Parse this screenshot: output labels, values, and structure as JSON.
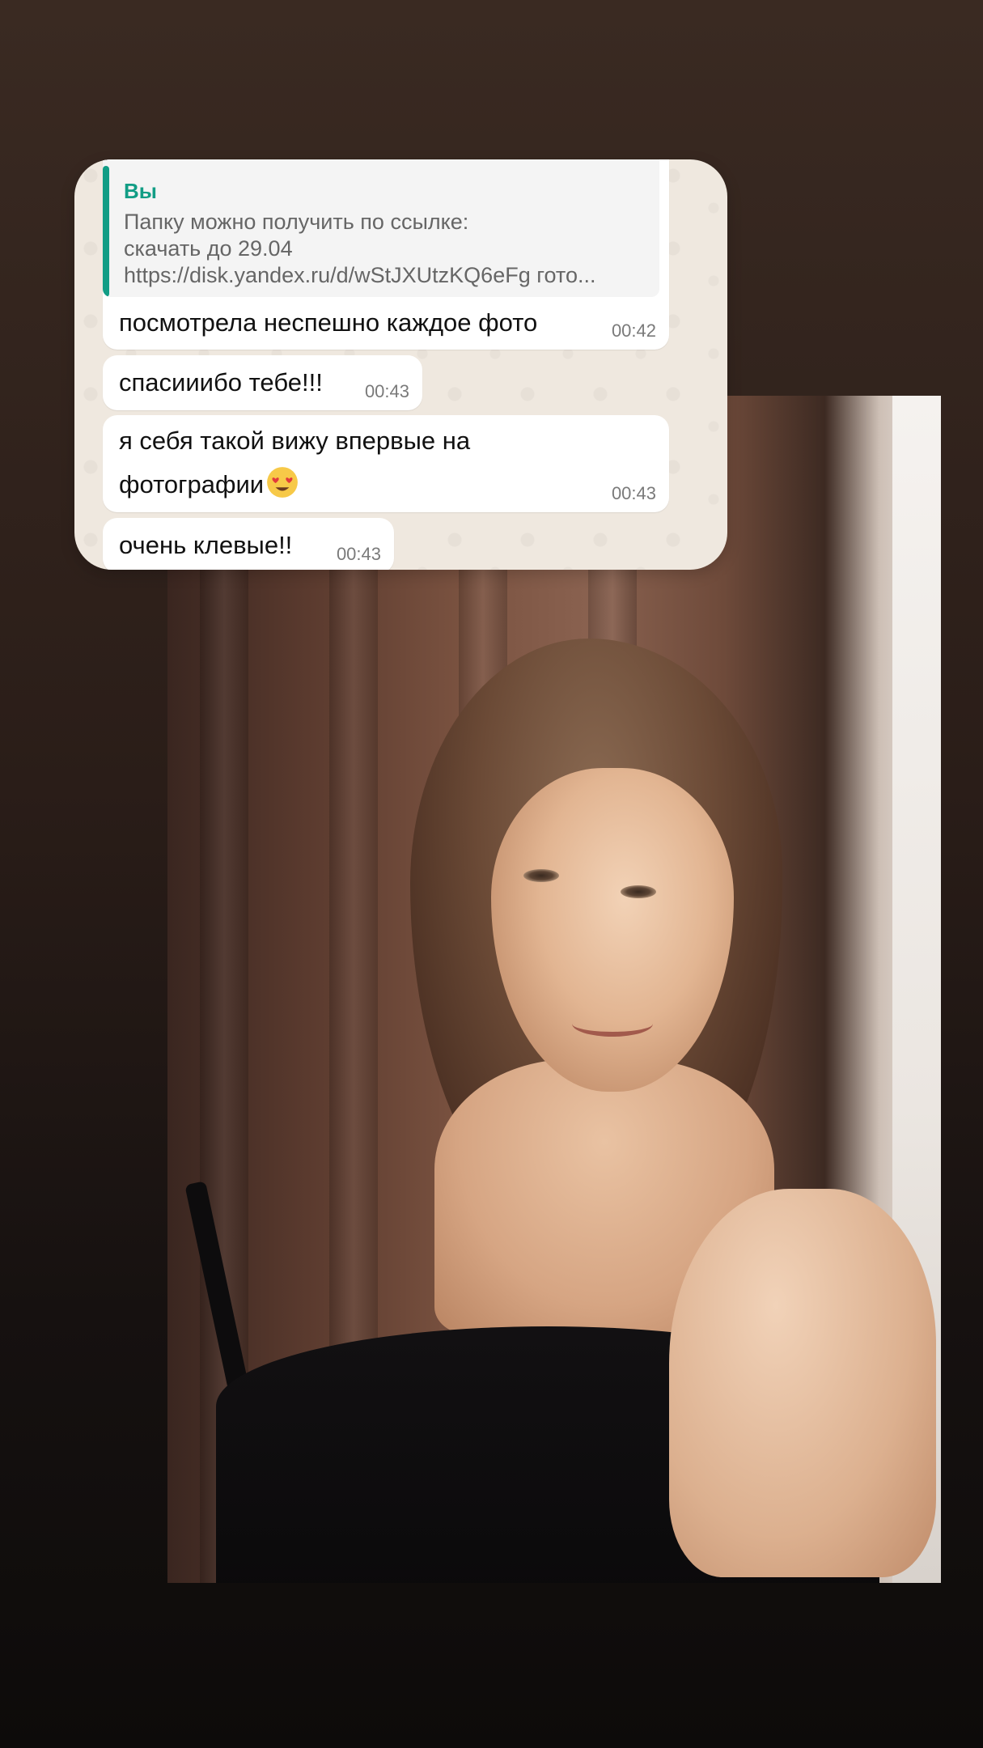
{
  "chat": {
    "quote": {
      "author": "Вы",
      "line1": "Папку можно получить по ссылке:",
      "line2": "скачать до 29.04",
      "line3": "https://disk.yandex.ru/d/wStJXUtzKQ6eFg гото..."
    },
    "messages": [
      {
        "text": "посмотрела неспешно каждое фото",
        "time": "00:42"
      },
      {
        "text": "спасииибо тебе!!!",
        "time": "00:43"
      },
      {
        "line1": "я себя такой вижу впервые на",
        "line2": "фотографии",
        "emoji": "heart-eyes-emoji",
        "time": "00:43"
      },
      {
        "text": "очень клевые!!",
        "time": "00:43"
      }
    ]
  },
  "colors": {
    "accent": "#129d85",
    "card_bg": "#efe8df",
    "bubble_bg": "#ffffff",
    "time_text": "#7a7a7a"
  }
}
